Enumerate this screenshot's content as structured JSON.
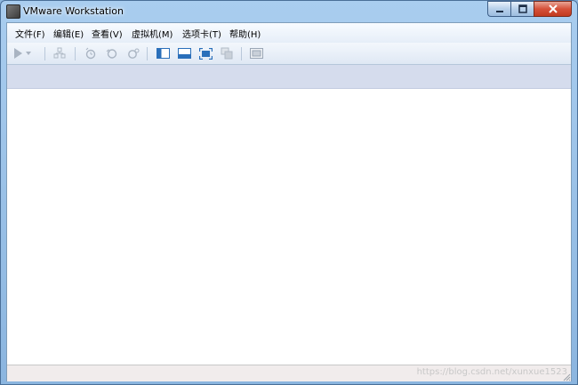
{
  "window": {
    "title": "VMware Workstation"
  },
  "menu": {
    "items": [
      {
        "label": "文件(F)"
      },
      {
        "label": "编辑(E)"
      },
      {
        "label": "查看(V)"
      },
      {
        "label": "虚拟机(M)"
      },
      {
        "label": "选项卡(T)"
      },
      {
        "label": "帮助(H)"
      }
    ]
  },
  "toolbar": {
    "icons": [
      "play-icon",
      "dropdown-arrow-icon",
      "network-icon",
      "snapshot-icon",
      "revert-snapshot-icon",
      "snapshot-manager-icon",
      "library-view-icon",
      "thumbnail-bar-icon",
      "full-screen-icon",
      "unity-icon",
      "console-view-icon"
    ]
  },
  "status": {
    "watermark": "https://blog.csdn.net/xunxue1523"
  },
  "colors": {
    "accent": "#2a6fba",
    "tabstrip": "#d5dced",
    "close": "#c23a1e"
  }
}
